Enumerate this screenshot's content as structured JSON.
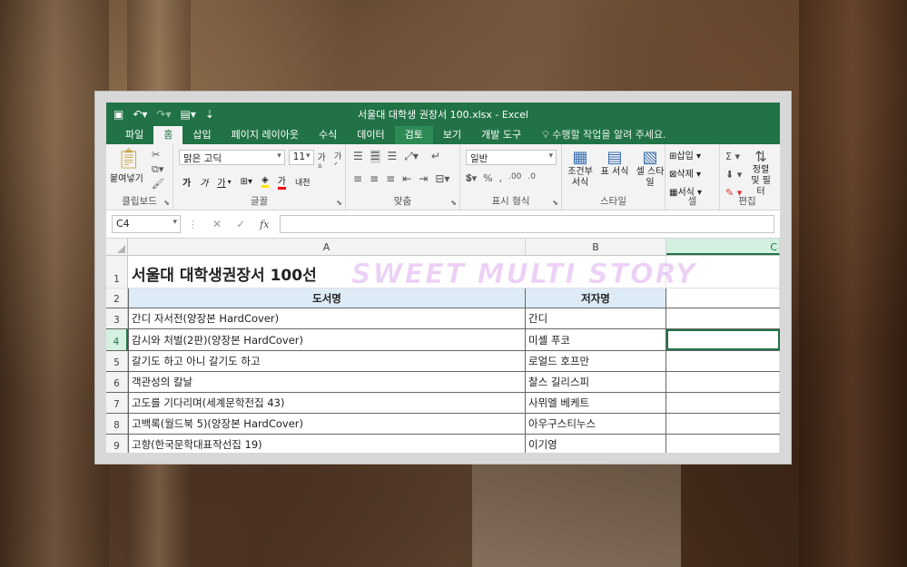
{
  "window": {
    "title": "서울대 대학생 권장서 100.xlsx - Excel"
  },
  "ribbon_tabs": [
    "파일",
    "홈",
    "삽입",
    "페이지 레이아웃",
    "수식",
    "데이터",
    "검토",
    "보기",
    "개발 도구"
  ],
  "active_tab": "홈",
  "tell_me": "수행할 작업을 알려 주세요.",
  "clipboard": {
    "paste_label": "붙여넣기",
    "group_label": "클립보드"
  },
  "font": {
    "name": "맑은 고딕",
    "size": "11",
    "bold": "가",
    "italic": "가",
    "underline": "가",
    "font_color": "가",
    "ruby": "내천",
    "group_label": "글꼴"
  },
  "alignment": {
    "group_label": "맞춤"
  },
  "number": {
    "format": "일반",
    "group_label": "표시 형식"
  },
  "styles": {
    "conditional": "조건부 서식",
    "table": "표 서식",
    "cell": "셀 스타일",
    "group_label": "스타일"
  },
  "cells": {
    "insert": "삽입",
    "delete": "삭제",
    "format": "서식",
    "group_label": "셀"
  },
  "editing": {
    "sort": "정렬 및 필터",
    "group_label": "편집"
  },
  "formula_bar": {
    "name_box": "C4",
    "fx": "fx",
    "value": ""
  },
  "columns": [
    "A",
    "B",
    "C"
  ],
  "selected_column": "C",
  "selected_row": "4",
  "sheet": {
    "title": "서울대 대학생권장서 100선",
    "headers": {
      "A": "도서명",
      "B": "저자명"
    },
    "rows": [
      {
        "num": "3",
        "A": "간디 자서전(양장본 HardCover)",
        "B": "간디"
      },
      {
        "num": "4",
        "A": "감시와 처벌(2판)(양장본 HardCover)",
        "B": "미셸 푸코"
      },
      {
        "num": "5",
        "A": "갈기도 하고 아니 갈기도 하고",
        "B": "로얼드 호프만"
      },
      {
        "num": "6",
        "A": "객관성의 칼날",
        "B": "찰스 길리스피"
      },
      {
        "num": "7",
        "A": "고도를 기다리며(세계문학전집 43)",
        "B": "사뮈엘 베케트"
      },
      {
        "num": "8",
        "A": "고백록(월드북 5)(양장본 HardCover)",
        "B": "아우구스티누스"
      },
      {
        "num": "9",
        "A": "고향(한국문학대표작선집 19)",
        "B": "이기영"
      }
    ]
  },
  "watermark": "SWEET MULTI STORY"
}
